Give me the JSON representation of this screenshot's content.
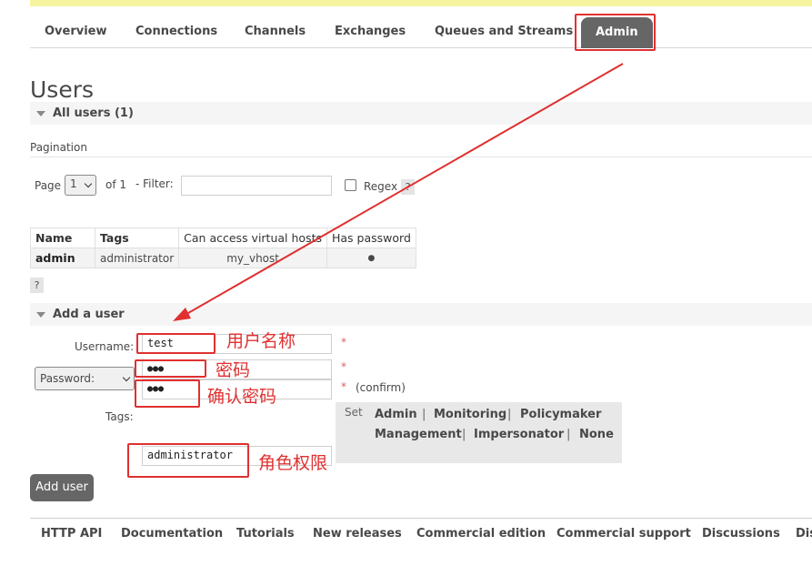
{
  "nav": {
    "tabs": [
      {
        "label": "Overview"
      },
      {
        "label": "Connections"
      },
      {
        "label": "Channels"
      },
      {
        "label": "Exchanges"
      },
      {
        "label": "Queues and Streams"
      },
      {
        "label": "Admin",
        "active": true
      }
    ]
  },
  "page": {
    "title": "Users"
  },
  "all_users": {
    "header": "All users (1)",
    "pagination_label": "Pagination",
    "page_label": "Page",
    "page_value": "1",
    "of_label": "of 1",
    "filter_label": "- Filter:",
    "filter_value": "",
    "regex_label": "Regex",
    "help": "?"
  },
  "table": {
    "columns": [
      "Name",
      "Tags",
      "Can access virtual hosts",
      "Has password"
    ],
    "rows": [
      {
        "name": "admin",
        "tags": "administrator",
        "vhosts": "my_vhost",
        "has_password": "●"
      }
    ],
    "help": "?"
  },
  "add_user": {
    "header": "Add a user",
    "username_label": "Username:",
    "username_value": "test",
    "password_select": "Password:",
    "password_value": "●●●",
    "confirm_value": "●●●",
    "confirm_label": "(confirm)",
    "required_mark": "*",
    "tags_label": "Tags:",
    "tags_value": "administrator",
    "tags_help": "?",
    "set_label": "Set",
    "tag_options": [
      "Admin",
      "Monitoring",
      "Policymaker",
      "Management",
      "Impersonator",
      "None"
    ],
    "separator": "|",
    "submit": "Add user"
  },
  "footer": {
    "links": [
      "HTTP API",
      "Documentation",
      "Tutorials",
      "New releases",
      "Commercial edition",
      "Commercial support",
      "Discussions",
      "Dis"
    ]
  },
  "annotations": {
    "username": "用户名称",
    "password": "密码",
    "confirm": "确认密码",
    "tags": "角色权限"
  },
  "colors": {
    "accent": "#666666",
    "annotation": "#e03030",
    "top_bar": "#f5f5a0"
  }
}
